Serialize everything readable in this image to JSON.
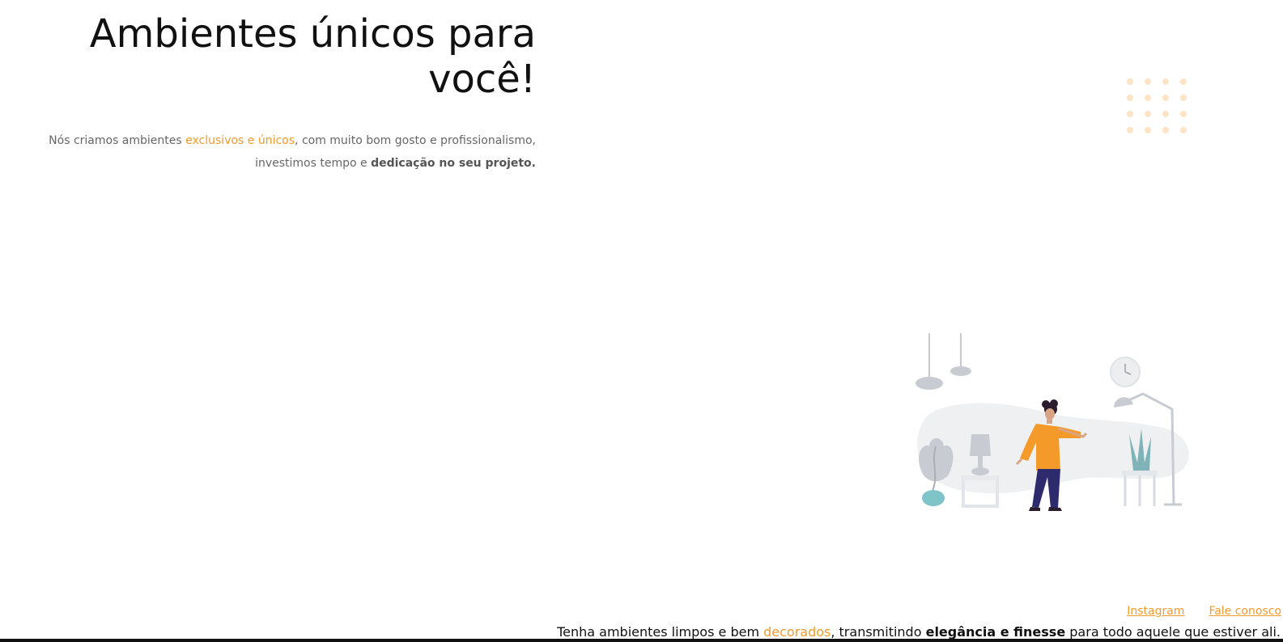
{
  "hero": {
    "title": "Ambientes únicos para você!",
    "text_before": "Nós criamos ambientes ",
    "text_accent": "exclusivos e únicos",
    "text_middle": ", com muito bom gosto e profissionalismo, investimos tempo e ",
    "text_bold": "dedicação no seu projeto."
  },
  "footer": {
    "links": [
      "Instagram",
      "Fale conosco"
    ],
    "tagline_before": "Tenha ambientes limpos e bem ",
    "tagline_accent": "decorados",
    "tagline_middle": ", transmitindo ",
    "tagline_bold": "elegância e finesse",
    "tagline_after": " para todo aquele que estiver ali."
  },
  "colors": {
    "accent": "#f39a2b",
    "dots": "#fde4c6"
  },
  "decorations": {
    "dot_grid_icon": "dot-grid",
    "illustration": "person-in-decorated-room"
  }
}
